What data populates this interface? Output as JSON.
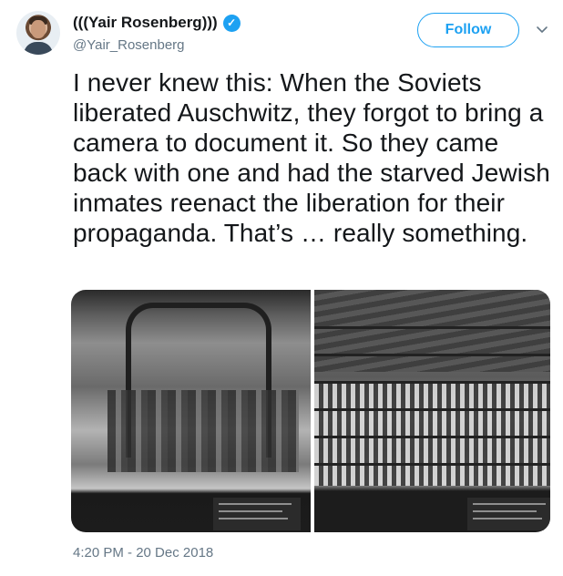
{
  "author": {
    "display_name": "(((Yair Rosenberg)))",
    "handle": "@Yair_Rosenberg",
    "verified_icon": "verified-badge-icon"
  },
  "follow_label": "Follow",
  "tweet": {
    "text": "I never knew this: When the Soviets liberated Auschwitz, they forgot to bring a camera to document it. So they came back with one and had the starved Jewish inmates reenact the liberation for their propaganda. That’s … really something.",
    "timestamp": "4:20 PM - 20 Dec 2018"
  },
  "colors": {
    "accent": "#1da1f2",
    "text": "#14171a",
    "secondary": "#657786"
  },
  "icons": {
    "verified": "verified-badge-icon",
    "more": "chevron-down-icon"
  }
}
